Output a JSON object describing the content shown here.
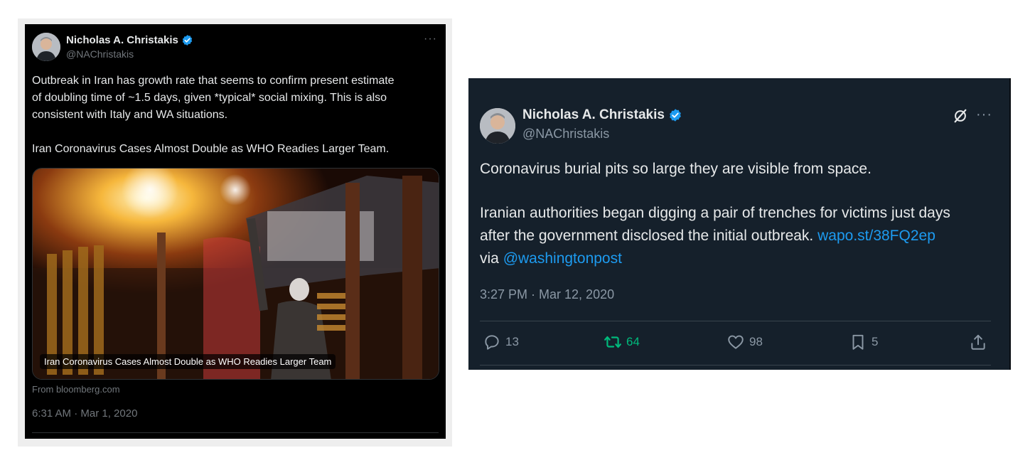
{
  "left_tweet": {
    "author_name": "Nicholas A. Christakis",
    "handle": "@NAChristakis",
    "more_label": "···",
    "text_lines": [
      "Outbreak in Iran has growth rate that seems to confirm present estimate",
      "of doubling time of ~1.5 days, given *typical* social mixing. This is also",
      "consistent with Italy and WA situations."
    ],
    "headline": "Iran Coronavirus Cases Almost Double as WHO Readies Larger Team.",
    "card_caption": "Iran Coronavirus Cases Almost Double as WHO Readies Larger Team",
    "card_source": "From bloomberg.com",
    "timestamp": "6:31 AM · Mar 1, 2020"
  },
  "right_tweet": {
    "author_name": "Nicholas A. Christakis",
    "handle": "@NAChristakis",
    "more_label": "···",
    "paragraph1": "Coronavirus burial pits so large they are visible from space.",
    "line2": "Iranian authorities began digging a pair of trenches for victims just days",
    "line3_text": "after the government disclosed the initial outbreak. ",
    "line3_link": "wapo.st/38FQ2ep",
    "line4_text": "via ",
    "line4_link": "@washingtonpost",
    "timestamp": "3:27 PM · Mar 12, 2020",
    "actions": {
      "reply_count": "13",
      "retweet_count": "64",
      "like_count": "98",
      "bookmark_count": "5"
    }
  },
  "colors": {
    "left_background": "#000000",
    "right_background": "#15202b",
    "link": "#1d9bf0",
    "verified": "#1d9bf0",
    "retweet": "#00ba7c",
    "muted": "#8b98a5"
  }
}
